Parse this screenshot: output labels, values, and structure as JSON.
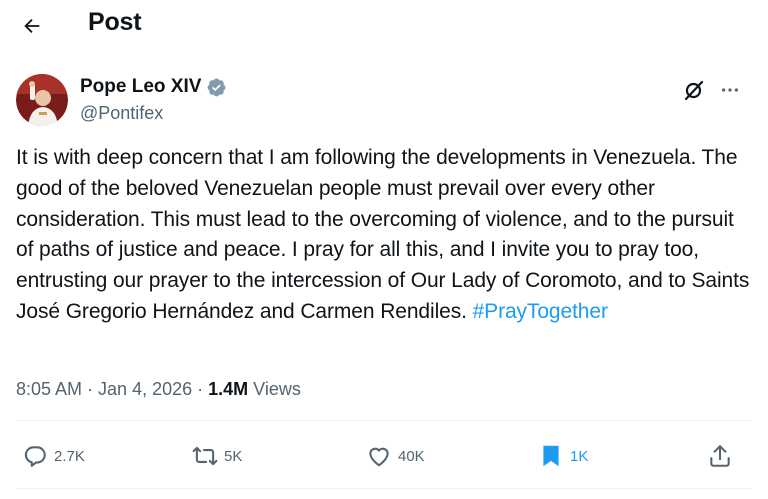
{
  "header": {
    "title": "Post",
    "back_icon": "arrow-left-icon"
  },
  "author": {
    "name": "Pope Leo XIV",
    "handle": "@Pontifex",
    "verified_icon": "verified-badge-icon",
    "verified_color": "#829aab"
  },
  "tweet": {
    "text": "It is with deep concern that I am following the developments in Venezuela. The good of the beloved Venezuelan people must prevail over every other consideration. This must lead to the overcoming of violence, and to the pursuit of paths of justice and peace.  I pray for all this, and I invite you to pray too, entrusting our prayer to the intercession of Our Lady of Coromoto, and to Saints José Gregorio Hernández and Carmen Rendiles. ",
    "hashtag": "#PrayTogether"
  },
  "meta": {
    "time": "8:05 AM",
    "separator": " · ",
    "date": "Jan 4, 2026",
    "views_count": "1.4M",
    "views_label": "Views"
  },
  "actions": {
    "reply": "2.7K",
    "repost": "5K",
    "like": "40K",
    "bookmark": "1K"
  },
  "colors": {
    "accent": "#1d9bf0",
    "text": "#0f1419",
    "secondary": "#536471"
  }
}
